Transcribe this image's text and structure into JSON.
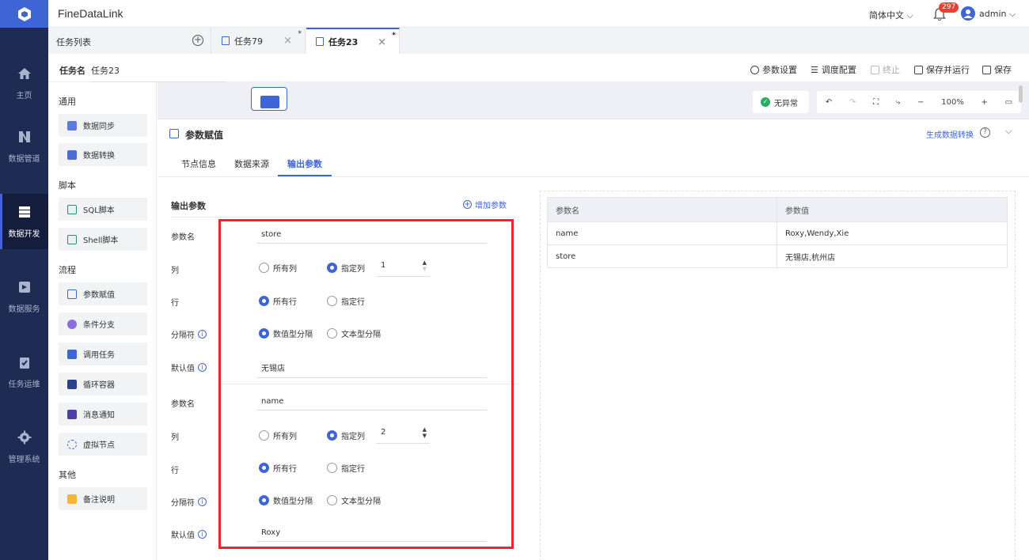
{
  "app": {
    "title": "FineDataLink",
    "language": "简体中文",
    "notification_count": "297",
    "user": "admin"
  },
  "nav": [
    {
      "label": "主页",
      "icon": "home-icon"
    },
    {
      "label": "数据管道",
      "icon": "pipeline-icon"
    },
    {
      "label": "数据开发",
      "icon": "dev-icon",
      "active": true
    },
    {
      "label": "数据服务",
      "icon": "service-icon"
    },
    {
      "label": "任务运维",
      "icon": "ops-icon"
    },
    {
      "label": "管理系统",
      "icon": "gear-icon"
    }
  ],
  "tabs": {
    "task_list": "任务列表",
    "items": [
      {
        "label": "任务79"
      },
      {
        "label": "任务23",
        "active": true
      }
    ],
    "modified_mark": "*"
  },
  "task": {
    "name_label": "任务名",
    "name": "任务23"
  },
  "toolbar": {
    "params": "参数设置",
    "schedule": "调度配置",
    "stop": "终止",
    "save_run": "保存并运行",
    "save": "保存"
  },
  "components": {
    "groups": [
      {
        "title": "通用",
        "items": [
          "数据同步",
          "数据转换"
        ]
      },
      {
        "title": "脚本",
        "items": [
          "SQL脚本",
          "Shell脚本"
        ]
      },
      {
        "title": "流程",
        "items": [
          "参数赋值",
          "条件分支",
          "调用任务",
          "循环容器",
          "消息通知",
          "虚拟节点"
        ]
      },
      {
        "title": "其他",
        "items": [
          "备注说明"
        ]
      }
    ]
  },
  "canvas": {
    "status": "无异常",
    "zoom": "100%"
  },
  "detail": {
    "title": "参数赋值",
    "generate": "生成数据转换",
    "subtabs": [
      "节点信息",
      "数据来源",
      "输出参数"
    ],
    "form_title": "输出参数",
    "add_param": "增加参数",
    "labels": {
      "name": "参数名",
      "col": "列",
      "row": "行",
      "sep": "分隔符",
      "default": "默认值"
    },
    "options": {
      "all_cols": "所有列",
      "spec_col": "指定列",
      "all_rows": "所有行",
      "spec_row": "指定行",
      "num_sep": "数值型分隔",
      "text_sep": "文本型分隔"
    },
    "params": [
      {
        "name": "store",
        "col": "1",
        "default": "无锡店"
      },
      {
        "name": "name",
        "col": "2",
        "default": "Roxy"
      }
    ],
    "table": {
      "headers": [
        "参数名",
        "参数值"
      ],
      "rows": [
        [
          "name",
          "Roxy,Wendy,Xie"
        ],
        [
          "store",
          "无锡店,杭州店"
        ]
      ]
    }
  },
  "colors": {
    "accent": "#3f64d6",
    "nav_bg": "#1e2b52",
    "highlight": "#e8262b"
  }
}
